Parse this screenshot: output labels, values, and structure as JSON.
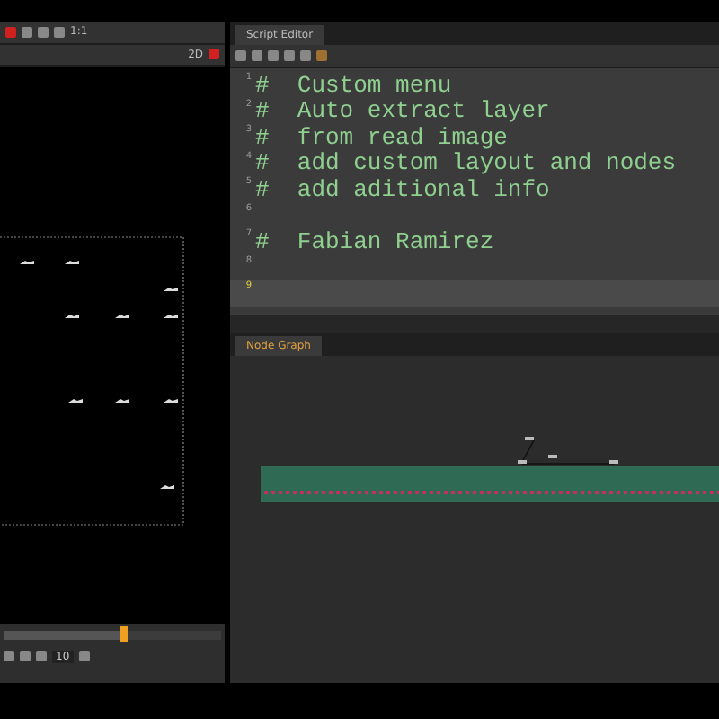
{
  "viewer": {
    "zoom": "1:1",
    "view_mode": "2D",
    "frame_field": "10",
    "timeline": {
      "level": 0.55
    }
  },
  "script_editor": {
    "tab": "Script Editor",
    "lines": [
      {
        "number": "1",
        "text": "#  Custom menu",
        "current": false
      },
      {
        "number": "2",
        "text": "#  Auto extract layer",
        "current": false
      },
      {
        "number": "3",
        "text": "#  from read image",
        "current": false
      },
      {
        "number": "4",
        "text": "#  add custom layout and nodes",
        "current": false
      },
      {
        "number": "5",
        "text": "#  add aditional info",
        "current": false
      },
      {
        "number": "6",
        "current": false
      },
      {
        "number": "7",
        "text": "#  Fabian Ramirez",
        "current": false
      },
      {
        "number": "8",
        "current": false
      },
      {
        "number": "9",
        "current": true
      }
    ]
  },
  "node_graph": {
    "tab": "Node Graph"
  }
}
